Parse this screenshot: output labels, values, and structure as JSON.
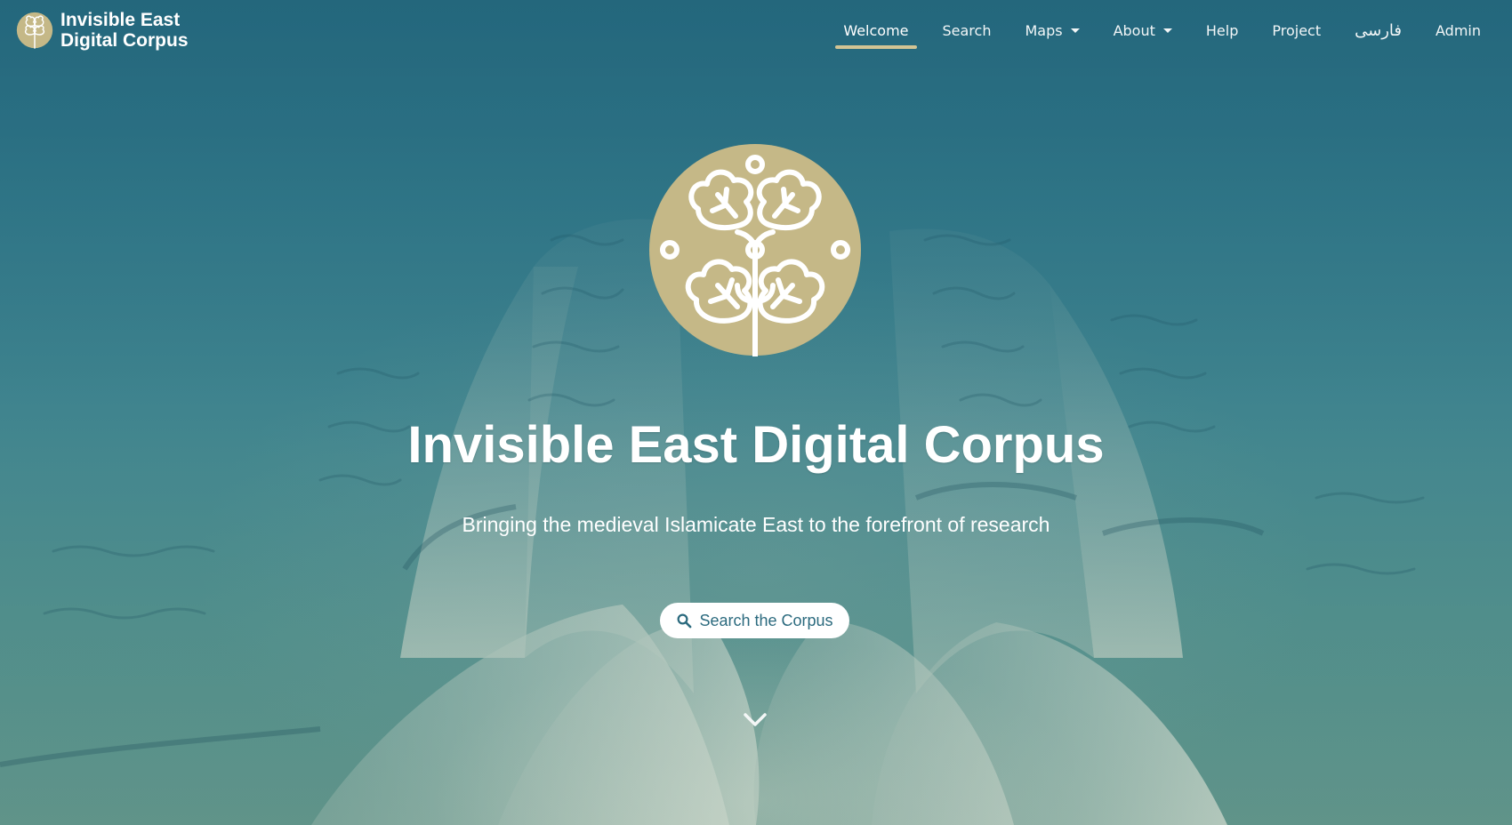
{
  "brand": {
    "line1": "Invisible East",
    "line2": "Digital Corpus",
    "logo_icon": "tree-emblem-icon"
  },
  "nav": {
    "items": [
      {
        "label": "Welcome",
        "active": true,
        "dropdown": false
      },
      {
        "label": "Search",
        "active": false,
        "dropdown": false
      },
      {
        "label": "Maps",
        "active": false,
        "dropdown": true
      },
      {
        "label": "About",
        "active": false,
        "dropdown": true
      },
      {
        "label": "Help",
        "active": false,
        "dropdown": false
      },
      {
        "label": "Project",
        "active": false,
        "dropdown": false
      },
      {
        "label": "فارسی",
        "active": false,
        "dropdown": false
      },
      {
        "label": "Admin",
        "active": false,
        "dropdown": false
      }
    ]
  },
  "hero": {
    "title": "Invisible East Digital Corpus",
    "subtitle": "Bringing the medieval Islamicate East to the forefront of research",
    "search_button_label": "Search the Corpus",
    "search_icon": "search-icon",
    "scroll_icon": "chevron-down-icon"
  },
  "colors": {
    "accent_gold": "#c5b887",
    "nav_underline": "#d2c494",
    "button_text": "#2b6a7e",
    "overlay_teal": "#2d6f84"
  }
}
